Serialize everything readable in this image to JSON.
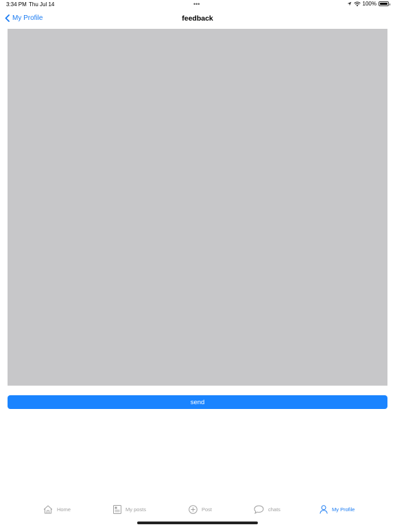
{
  "status_bar": {
    "time": "3:34 PM",
    "date": "Thu Jul 14",
    "dots": "•••",
    "battery": "100%",
    "icons": [
      "location-arrow-icon",
      "wifi-icon",
      "battery-icon"
    ]
  },
  "nav": {
    "back_label": "My Profile",
    "back_icon": "chevron-left-icon",
    "title": "feedback"
  },
  "feedback": {
    "value": "",
    "placeholder": ""
  },
  "send_label": "send",
  "tabs": [
    {
      "label": "Home",
      "icon": "home-icon",
      "active": false
    },
    {
      "label": "My posts",
      "icon": "posts-icon",
      "active": false
    },
    {
      "label": "Post",
      "icon": "plus-circle-icon",
      "active": false
    },
    {
      "label": "chats",
      "icon": "chat-bubble-icon",
      "active": false
    },
    {
      "label": "My Profile",
      "icon": "person-icon",
      "active": true
    }
  ],
  "colors": {
    "accent": "#1a7bf2",
    "send_button": "#1a84ff",
    "text_area": "#c7c7c9",
    "tab_inactive": "#a0a0a0"
  }
}
